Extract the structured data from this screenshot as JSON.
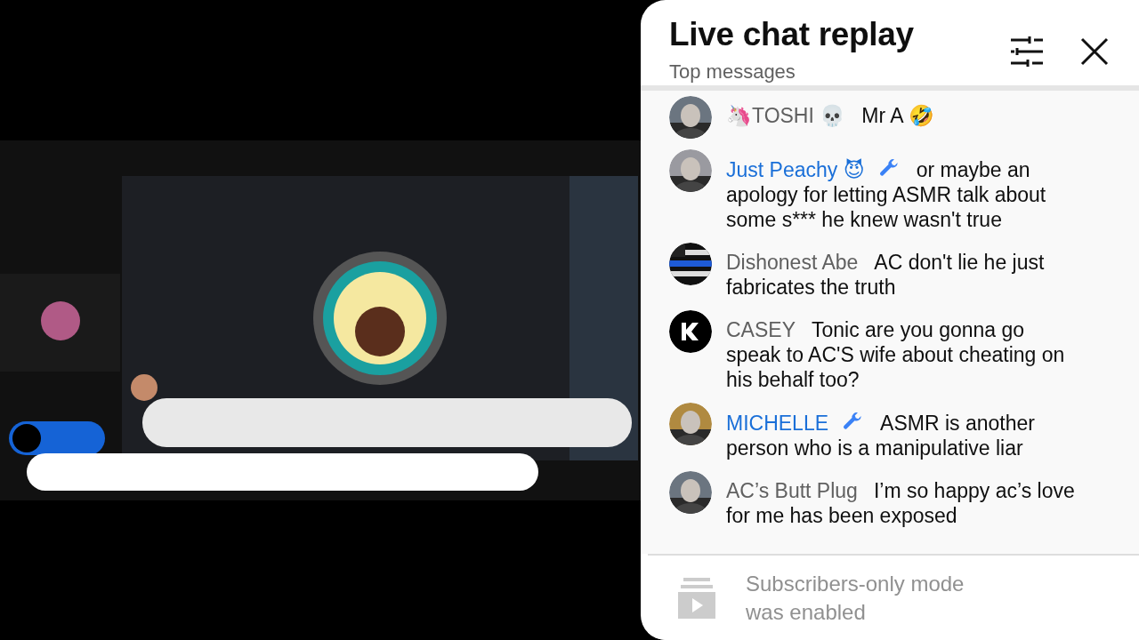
{
  "chat_panel": {
    "title": "Live chat replay",
    "subtitle": "Top messages"
  },
  "messages": [
    {
      "author": "🦄TOSHI 💀",
      "moderator": false,
      "kind": "picture",
      "text": "Mr A 🤣"
    },
    {
      "author": "Just Peachy 😈",
      "moderator": true,
      "kind": "picture",
      "text": "or maybe an apology for letting ASMR talk about some s*** he knew wasn't true"
    },
    {
      "author": "Dishonest Abe",
      "moderator": false,
      "kind": "flag",
      "text": "AC don't lie he just fabricates the truth"
    },
    {
      "author": "CASEY",
      "moderator": false,
      "kind": "logo",
      "text": "Tonic are you gonna go speak to AC'S wife about cheating on his behalf too?"
    },
    {
      "author": "MICHELLE",
      "moderator": true,
      "kind": "picture",
      "text": "ASMR is another person who is a manipulative liar"
    },
    {
      "author": "AC’s Butt Plug",
      "moderator": false,
      "kind": "picture",
      "text": "I’m so happy ac’s love for me has been exposed"
    }
  ],
  "footer": {
    "notice": "Subscribers-only mode was enabled"
  }
}
